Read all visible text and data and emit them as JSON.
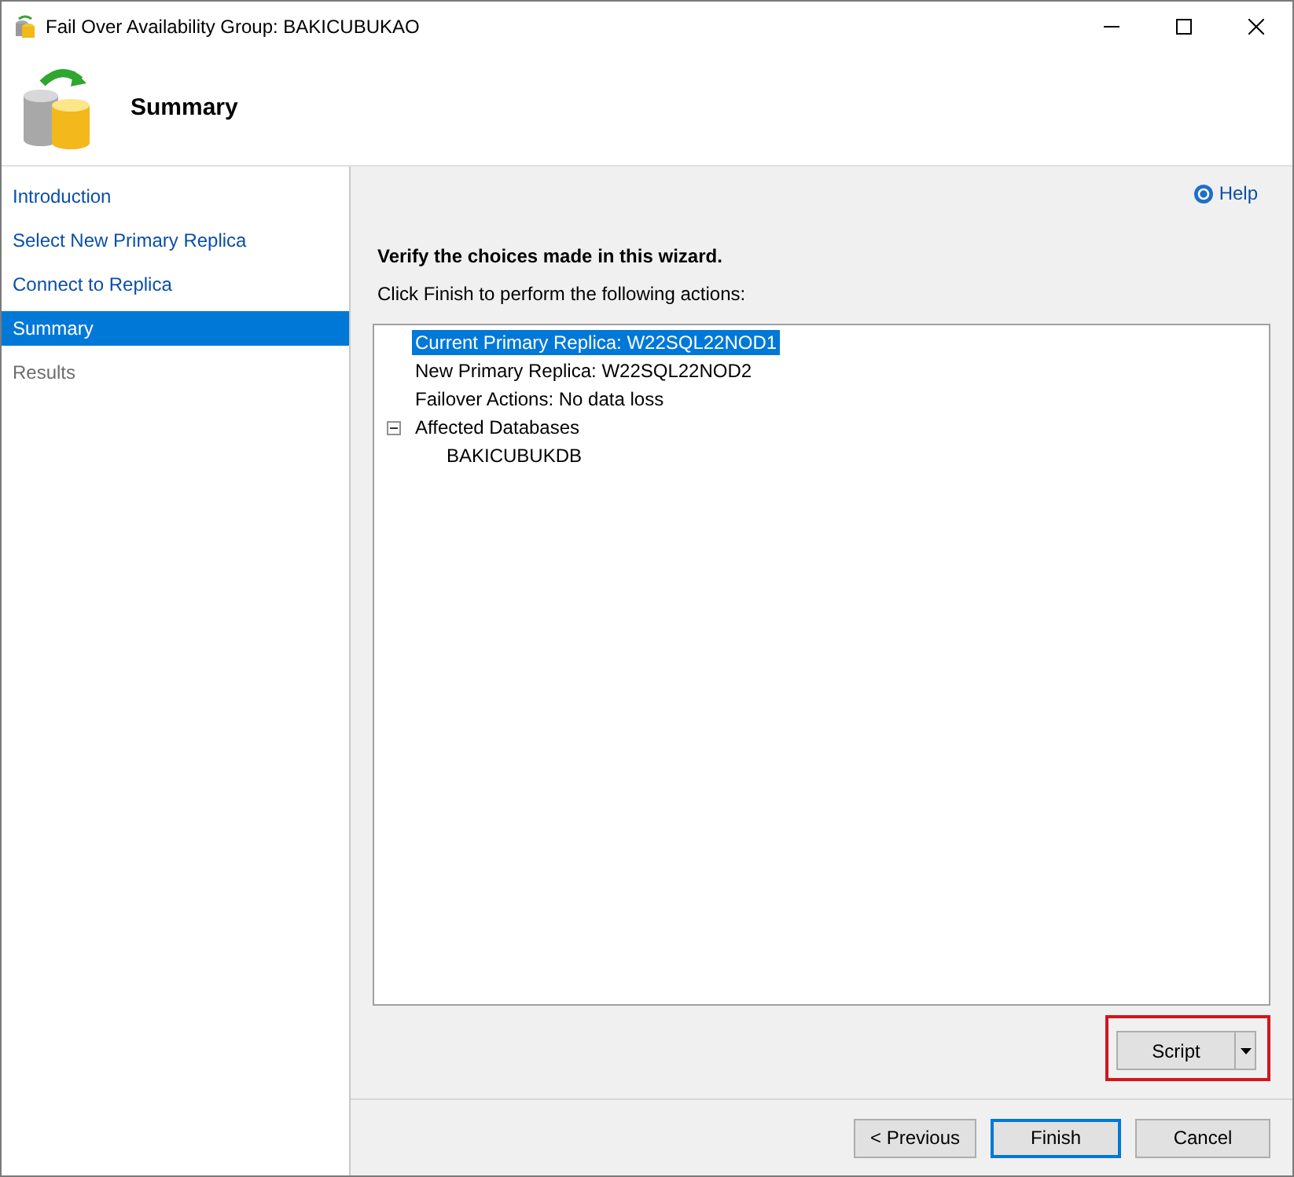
{
  "window": {
    "title": "Fail Over Availability Group: BAKICUBUKAO"
  },
  "header": {
    "title": "Summary"
  },
  "sidebar": {
    "items": [
      {
        "label": "Introduction",
        "selected": false,
        "disabled": false
      },
      {
        "label": "Select New Primary Replica",
        "selected": false,
        "disabled": false
      },
      {
        "label": "Connect to Replica",
        "selected": false,
        "disabled": false
      },
      {
        "label": "Summary",
        "selected": true,
        "disabled": false
      },
      {
        "label": "Results",
        "selected": false,
        "disabled": true
      }
    ]
  },
  "help": {
    "label": "Help"
  },
  "content": {
    "heading": "Verify the choices made in this wizard.",
    "instruction": "Click Finish to perform the following actions:"
  },
  "tree": [
    {
      "label": "Current Primary Replica: W22SQL22NOD1",
      "selected": true
    },
    {
      "label": "New Primary Replica: W22SQL22NOD2",
      "selected": false
    },
    {
      "label": "Failover Actions: No data loss",
      "selected": false
    },
    {
      "label": "Affected Databases",
      "selected": false,
      "expanded": true,
      "children": [
        {
          "label": "BAKICUBUKDB",
          "selected": false
        }
      ]
    }
  ],
  "script_button": {
    "label": "Script",
    "highlighted": true
  },
  "buttons": [
    {
      "label": "< Previous",
      "default": false
    },
    {
      "label": "Finish",
      "default": true
    },
    {
      "label": "Cancel",
      "default": false
    }
  ]
}
